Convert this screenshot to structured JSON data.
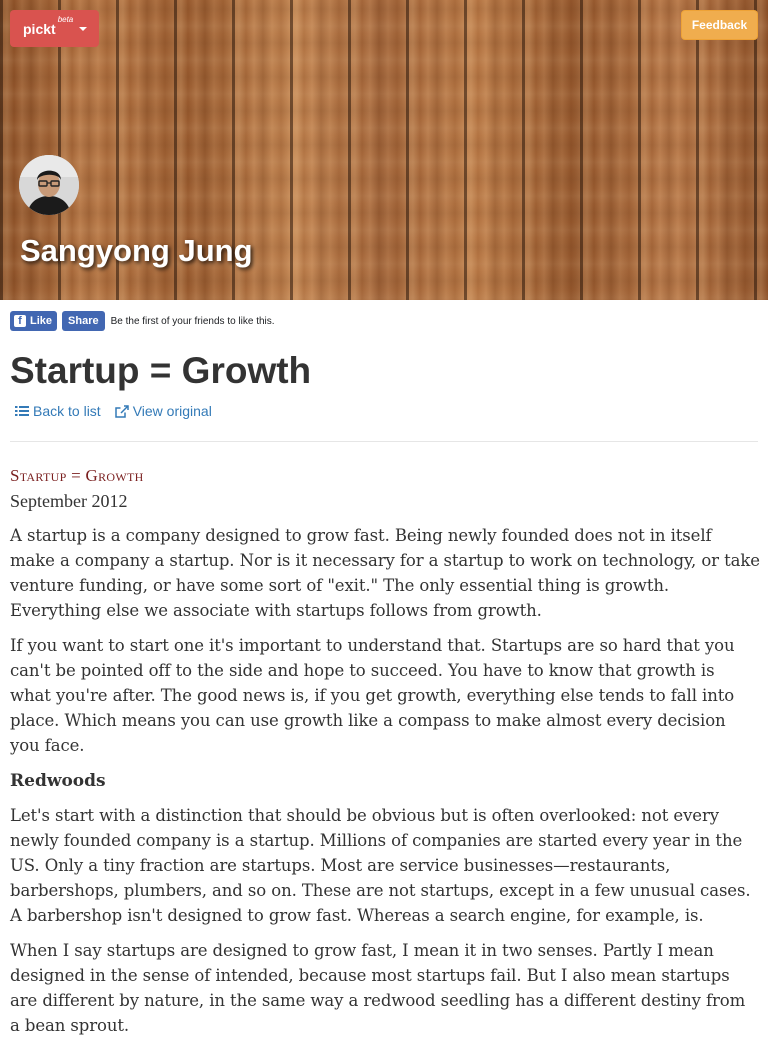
{
  "header": {
    "brand": "pickt",
    "brand_badge": "beta",
    "feedback_label": "Feedback",
    "profile_name": "Sangyong Jung"
  },
  "social": {
    "like_label": "Like",
    "share_label": "Share",
    "social_text": "Be the first of your friends to like this."
  },
  "article": {
    "title": "Startup = Growth",
    "back_label": "Back to list",
    "original_label": "View original",
    "kicker": "Startup = Growth",
    "date": "September 2012",
    "paragraphs": [
      "A startup is a company designed to grow fast. Being newly founded does not in itself make a company a startup. Nor is it necessary for a startup to work on technology, or take venture funding, or have some sort of \"exit.\" The only essential thing is growth. Everything else we associate with startups follows from growth.",
      "If you want to start one it's important to understand that. Startups are so hard that you can't be pointed off to the side and hope to succeed. You have to know that growth is what you're after. The good news is, if you get growth, everything else tends to fall into place. Which means you can use growth like a compass to make almost every decision you face."
    ],
    "section_heading": "Redwoods",
    "section_paragraphs": [
      "Let's start with a distinction that should be obvious but is often overlooked: not every newly founded company is a startup. Millions of companies are started every year in the US. Only a tiny fraction are startups. Most are service businesses—restaurants, barbershops, plumbers, and so on. These are not startups, except in a few unusual cases. A barbershop isn't designed to grow fast. Whereas a search engine, for example, is.",
      "When I say startups are designed to grow fast, I mean it in two senses. Partly I mean designed in the sense of intended, because most startups fail. But I also mean startups are different by nature, in the same way a redwood seedling has a different destiny from a bean sprout."
    ]
  },
  "colors": {
    "brand": "#d9534f",
    "feedback": "#f0ad4e",
    "link": "#337ab7",
    "facebook": "#4267b2",
    "kicker": "#7a1f1f"
  },
  "icons": {
    "list": "list-icon",
    "external": "external-link-icon",
    "facebook": "facebook-icon",
    "caret": "caret-down-icon"
  }
}
